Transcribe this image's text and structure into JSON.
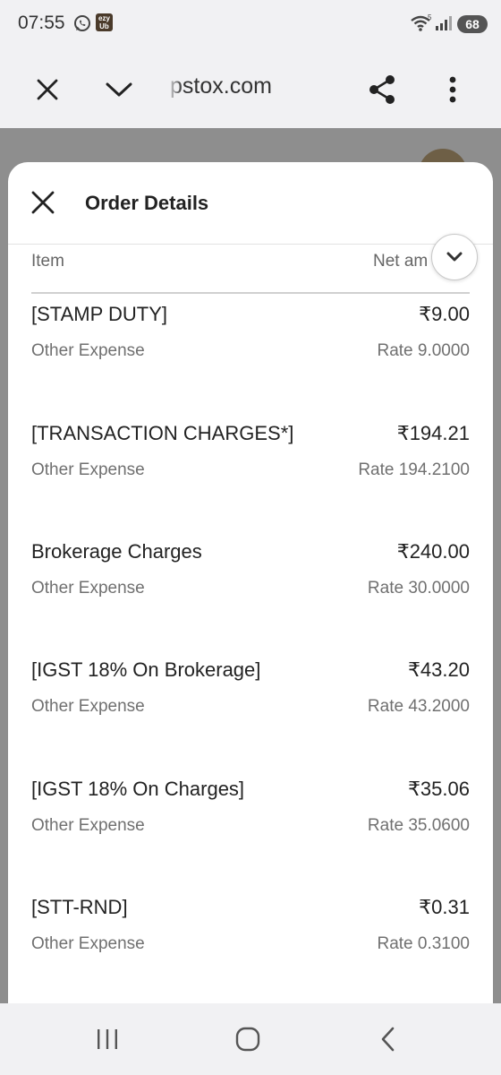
{
  "status_bar": {
    "time": "07:55",
    "ezy_badge": "ezy Ub",
    "battery": "68",
    "network": "5"
  },
  "browser": {
    "url": "pstox.com"
  },
  "sheet": {
    "title": "Order Details",
    "col_item": "Item",
    "col_net": "Net am"
  },
  "rows": [
    {
      "name": "[STAMP DUTY]",
      "amount": "₹9.00",
      "type": "Other Expense",
      "rate": "Rate 9.0000"
    },
    {
      "name": "[TRANSACTION CHARGES*]",
      "amount": "₹194.21",
      "type": "Other Expense",
      "rate": "Rate 194.2100"
    },
    {
      "name": "Brokerage Charges",
      "amount": "₹240.00",
      "type": "Other Expense",
      "rate": "Rate 30.0000"
    },
    {
      "name": "[IGST 18% On Brokerage]",
      "amount": "₹43.20",
      "type": "Other Expense",
      "rate": "Rate 43.2000"
    },
    {
      "name": "[IGST 18% On Charges]",
      "amount": "₹35.06",
      "type": "Other Expense",
      "rate": "Rate 35.0600"
    },
    {
      "name": "[STT-RND]",
      "amount": "₹0.31",
      "type": "Other Expense",
      "rate": "Rate 0.3100"
    }
  ],
  "icons": {
    "close": "close-icon",
    "chevron": "chevron-down-icon",
    "share": "share-icon",
    "more": "more-vert-icon",
    "recents": "recents-icon",
    "home": "home-icon",
    "back": "back-icon"
  },
  "colors": {
    "sheet_bg": "#ffffff",
    "overlay": "#8e8e8e",
    "bar_bg": "#f1f1f3",
    "muted_text": "#707070"
  }
}
